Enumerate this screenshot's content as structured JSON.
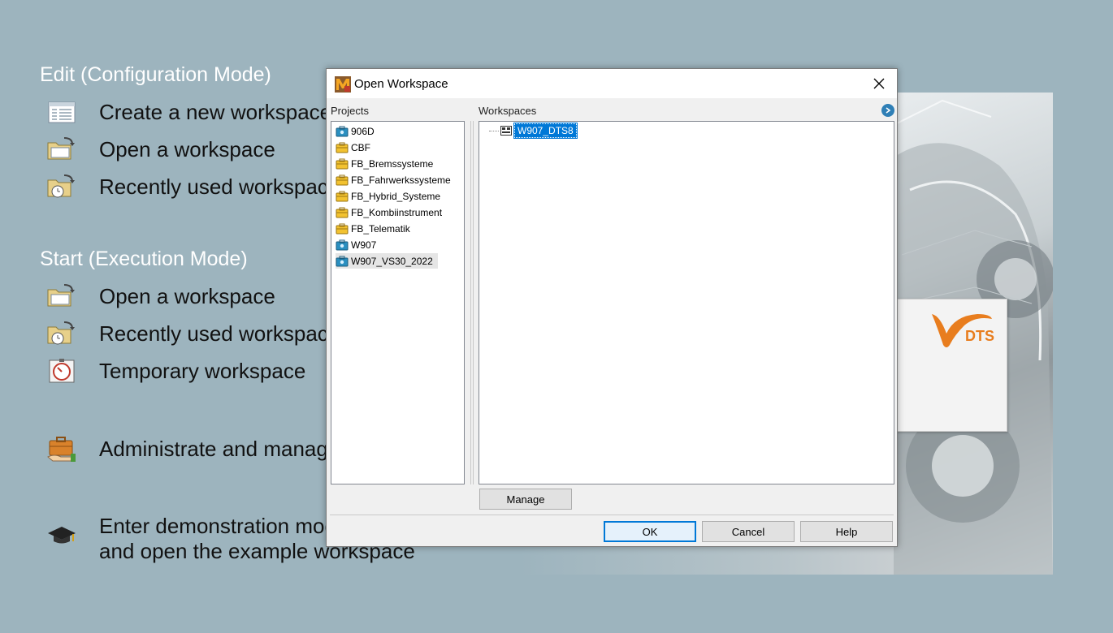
{
  "launcher": {
    "edit_title": "Edit (Configuration Mode)",
    "start_title": "Start (Execution Mode)",
    "items": {
      "create_new": "Create a new workspace",
      "open_edit": "Open a workspace",
      "recent_edit": "Recently used workspaces",
      "open_start": "Open a workspace",
      "recent_start": "Recently used workspaces",
      "temporary": "Temporary workspace",
      "administrate": "Administrate and manage",
      "demo_line1": "Enter demonstration mode",
      "demo_line2": "and open the example workspace"
    },
    "brand": "DTS"
  },
  "dialog": {
    "title": "Open Workspace",
    "projects_label": "Projects",
    "workspaces_label": "Workspaces",
    "projects": [
      {
        "name": "906D",
        "icon": "project-blue-icon"
      },
      {
        "name": "CBF",
        "icon": "project-folder-icon"
      },
      {
        "name": "FB_Bremssysteme",
        "icon": "project-folder-icon"
      },
      {
        "name": "FB_Fahrwerkssysteme",
        "icon": "project-folder-icon"
      },
      {
        "name": "FB_Hybrid_Systeme",
        "icon": "project-folder-icon"
      },
      {
        "name": "FB_Kombiinstrument",
        "icon": "project-folder-icon"
      },
      {
        "name": "FB_Telematik",
        "icon": "project-folder-icon"
      },
      {
        "name": "W907",
        "icon": "project-blue-icon"
      },
      {
        "name": "W907_VS30_2022",
        "icon": "project-blue-icon"
      }
    ],
    "selected_project": "W907_VS30_2022",
    "workspaces": [
      {
        "name": "W907_DTS8",
        "selected": true
      }
    ],
    "buttons": {
      "manage": "Manage",
      "ok": "OK",
      "cancel": "Cancel",
      "help": "Help"
    },
    "colors": {
      "selection": "#0078d7",
      "folder": "#f2c230",
      "project_blue": "#2a8fc0"
    }
  }
}
